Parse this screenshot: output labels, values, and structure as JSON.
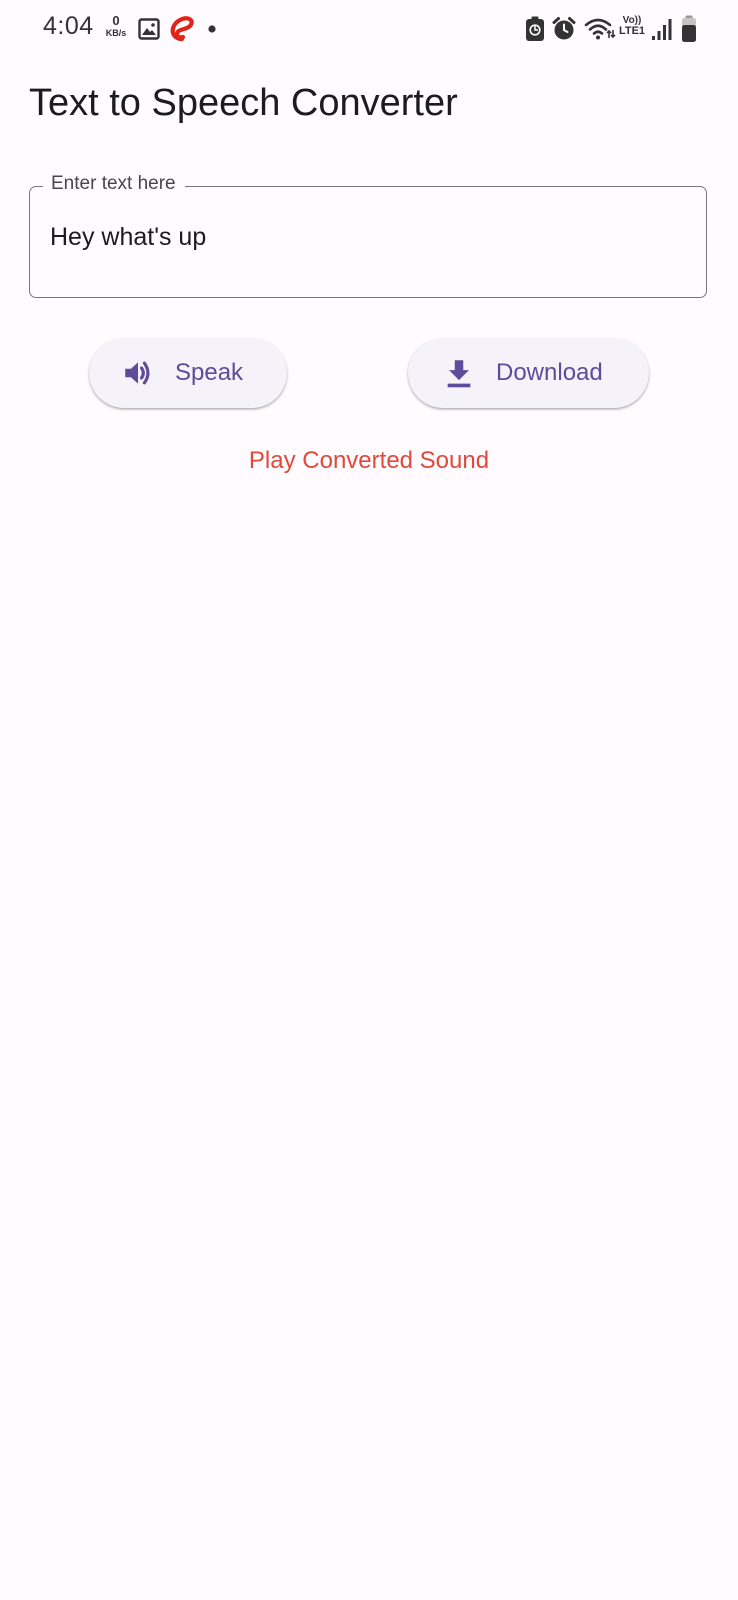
{
  "status_bar": {
    "time": "4:04",
    "network_speed_value": "0",
    "network_speed_unit": "KB/s",
    "volte_top": "Vo))",
    "volte_bottom": "LTE1",
    "icons": [
      "gallery-icon",
      "airtel-logo-icon",
      "notification-dot-icon",
      "battery-saver-icon",
      "alarm-icon",
      "wifi-icon",
      "signal-icon",
      "battery-icon"
    ]
  },
  "app": {
    "title": "Text to Speech Converter"
  },
  "text_field": {
    "label": "Enter text here",
    "value": "Hey what's up"
  },
  "buttons": {
    "speak": {
      "label": "Speak",
      "icon": "volume-icon"
    },
    "download": {
      "label": "Download",
      "icon": "download-icon"
    }
  },
  "play_link": {
    "label": "Play Converted Sound"
  },
  "colors": {
    "background": "#FFFBFE",
    "accent": "#5E4B9C",
    "button_surface": "#F6F2FA",
    "link": "#E04A3A",
    "outline": "#79747E"
  }
}
